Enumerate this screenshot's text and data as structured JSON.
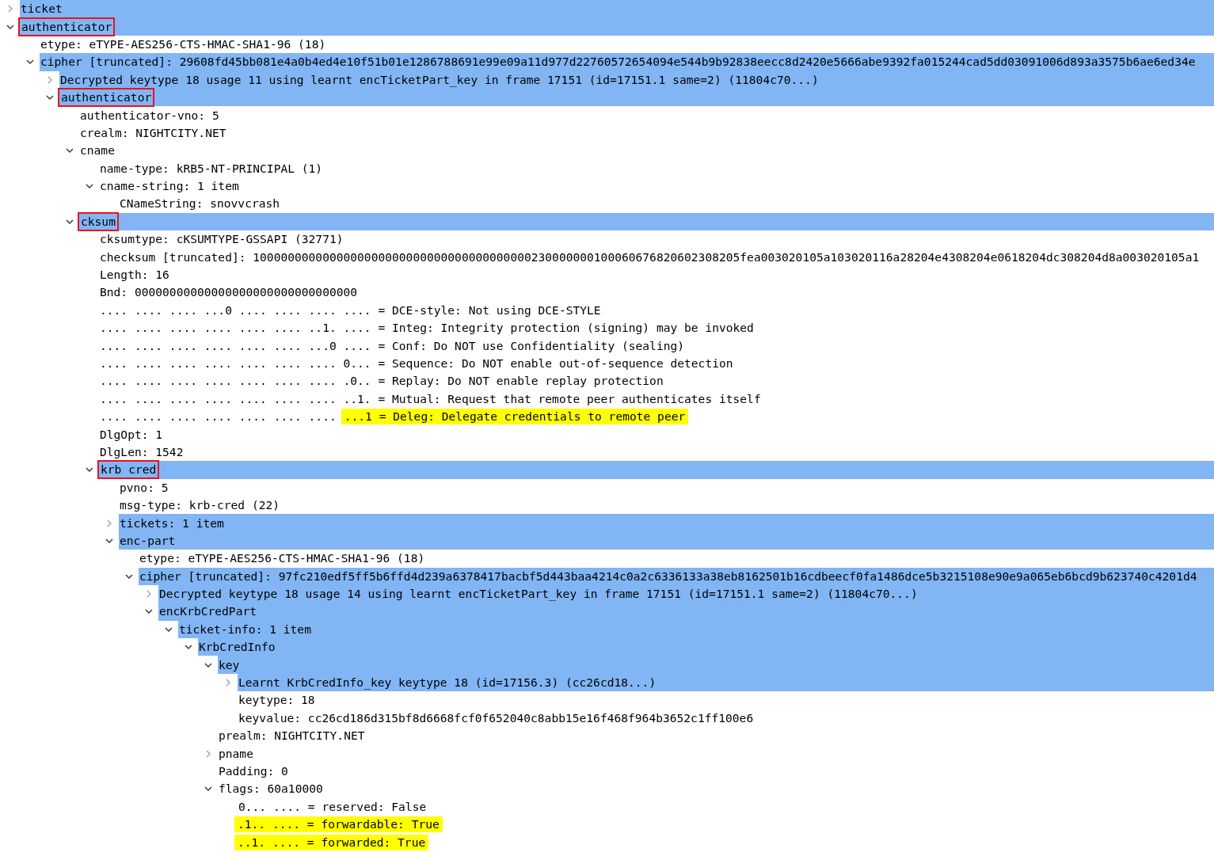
{
  "tree": [
    {
      "text": "ticket",
      "expanded": false,
      "selected": true
    },
    {
      "text": "authenticator",
      "expanded": true,
      "selected": true,
      "boxed": true,
      "children": [
        {
          "text": "etype: eTYPE-AES256-CTS-HMAC-SHA1-96 (18)"
        },
        {
          "text": "cipher [truncated]: 29608fd45bb081e4a0b4ed4e10f51b01e1286788691e99e09a11d977d22760572654094e544b9b92838eecc8d2420e5666abe9392fa015244cad5dd03091006d893a3575b6ae6ed34e",
          "expanded": true,
          "selected": true,
          "children": [
            {
              "text": "Decrypted keytype 18 usage 11 using learnt encTicketPart_key in frame 17151 (id=17151.1 same=2) (11804c70...)",
              "expanded": false,
              "selected": true
            },
            {
              "text": "authenticator",
              "expanded": true,
              "selected": true,
              "boxed": true,
              "children": [
                {
                  "text": "authenticator-vno: 5"
                },
                {
                  "text": "crealm: NIGHTCITY.NET"
                },
                {
                  "text": "cname",
                  "expanded": true,
                  "children": [
                    {
                      "text": "name-type: kRB5-NT-PRINCIPAL (1)"
                    },
                    {
                      "text": "cname-string: 1 item",
                      "expanded": true,
                      "children": [
                        {
                          "text": "CNameString: snovvcrash"
                        }
                      ]
                    }
                  ]
                },
                {
                  "text": "cksum",
                  "expanded": true,
                  "selected": true,
                  "boxed": true,
                  "children": [
                    {
                      "text": "cksumtype: cKSUMTYPE-GSSAPI (32771)"
                    },
                    {
                      "text": "checksum [truncated]: 1000000000000000000000000000000000000000230000000100060676820602308205fea003020105a103020116a28204e4308204e0618204dc308204d8a003020105a1"
                    },
                    {
                      "text": "Length: 16"
                    },
                    {
                      "text": "Bnd: 00000000000000000000000000000000"
                    },
                    {
                      "text": ".... .... .... ...0 .... .... .... .... = DCE-style: Not using DCE-STYLE"
                    },
                    {
                      "text": ".... .... .... .... .... .... ..1. .... = Integ: Integrity protection (signing) may be invoked"
                    },
                    {
                      "text": ".... .... .... .... .... .... ...0 .... = Conf: Do NOT use Confidentiality (sealing)"
                    },
                    {
                      "text": ".... .... .... .... .... .... .... 0... = Sequence: Do NOT enable out-of-sequence detection"
                    },
                    {
                      "text": ".... .... .... .... .... .... .... .0.. = Replay: Do NOT enable replay protection"
                    },
                    {
                      "text": ".... .... .... .... .... .... .... ..1. = Mutual: Request that remote peer authenticates itself"
                    },
                    {
                      "prefix": ".... .... .... .... .... .... ....",
                      "text": "...1 = Deleg: Delegate credentials to remote peer",
                      "highlighted": true
                    },
                    {
                      "text": "DlgOpt: 1"
                    },
                    {
                      "text": "DlgLen: 1542"
                    },
                    {
                      "text": "krb cred",
                      "expanded": true,
                      "selected": true,
                      "boxed": true,
                      "children": [
                        {
                          "text": "pvno: 5"
                        },
                        {
                          "text": "msg-type: krb-cred (22)"
                        },
                        {
                          "text": "tickets: 1 item",
                          "expanded": false,
                          "selected": true
                        },
                        {
                          "text": "enc-part",
                          "expanded": true,
                          "selected": true,
                          "children": [
                            {
                              "text": "etype: eTYPE-AES256-CTS-HMAC-SHA1-96 (18)"
                            },
                            {
                              "text": "cipher [truncated]: 97fc210edf5ff5b6ffd4d239a6378417bacbf5d443baa4214c0a2c6336133a38eb8162501b16cdbeecf0fa1486dce5b3215108e90e9a065eb6bcd9b623740c4201d4",
                              "expanded": true,
                              "selected": true,
                              "children": [
                                {
                                  "text": "Decrypted keytype 18 usage 14 using learnt encTicketPart_key in frame 17151 (id=17151.1 same=2) (11804c70...)",
                                  "expanded": false,
                                  "selected": true
                                },
                                {
                                  "text": "encKrbCredPart",
                                  "expanded": true,
                                  "selected": true,
                                  "children": [
                                    {
                                      "text": "ticket-info: 1 item",
                                      "expanded": true,
                                      "selected": true,
                                      "children": [
                                        {
                                          "text": "KrbCredInfo",
                                          "expanded": true,
                                          "selected": true,
                                          "children": [
                                            {
                                              "text": "key",
                                              "expanded": true,
                                              "selected": true,
                                              "children": [
                                                {
                                                  "text": "Learnt KrbCredInfo_key keytype 18 (id=17156.3) (cc26cd18...)",
                                                  "expanded": false,
                                                  "selected": true
                                                },
                                                {
                                                  "text": "keytype: 18"
                                                },
                                                {
                                                  "text": "keyvalue: cc26cd186d315bf8d6668fcf0f652040c8abb15e16f468f964b3652c1ff100e6"
                                                }
                                              ]
                                            },
                                            {
                                              "text": "prealm: NIGHTCITY.NET"
                                            },
                                            {
                                              "text": "pname",
                                              "expanded": false
                                            },
                                            {
                                              "text": "Padding: 0"
                                            },
                                            {
                                              "text": "flags: 60a10000",
                                              "expanded": true,
                                              "children": [
                                                {
                                                  "text": "0... .... = reserved: False"
                                                },
                                                {
                                                  "text": ".1.. .... = forwardable: True",
                                                  "highlighted": true
                                                },
                                                {
                                                  "text": "..1. .... = forwarded: True",
                                                  "highlighted": true
                                                }
                                              ]
                                            }
                                          ]
                                        }
                                      ]
                                    }
                                  ]
                                }
                              ]
                            }
                          ]
                        }
                      ]
                    }
                  ]
                }
              ]
            }
          ]
        }
      ]
    }
  ]
}
